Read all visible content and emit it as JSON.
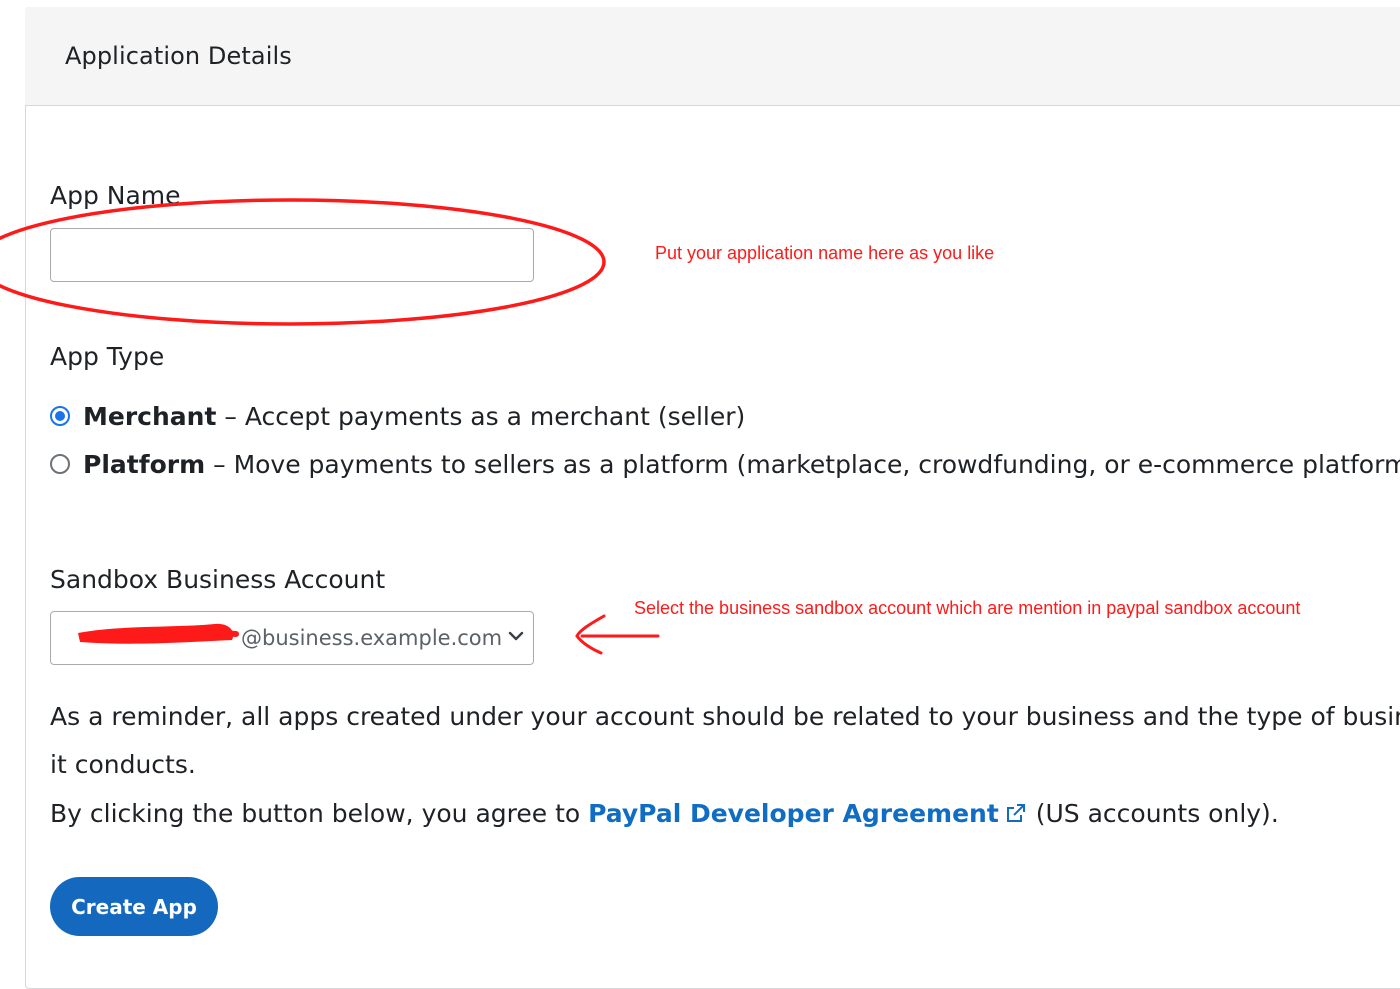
{
  "panel": {
    "title": "Application Details"
  },
  "form": {
    "app_name_label": "App Name",
    "app_name_value": "",
    "app_type_label": "App Type",
    "app_types": [
      {
        "title": "Merchant",
        "separator": " – ",
        "description": "Accept payments as a merchant (seller)",
        "selected": true
      },
      {
        "title": "Platform",
        "separator": " – ",
        "description": "Move payments to sellers as a platform (marketplace, crowdfunding, or e-commerce platform)",
        "selected": false
      }
    ],
    "sandbox_account_label": "Sandbox Business Account",
    "sandbox_account_value": "@business.example.com",
    "reminder_line1": "As a reminder, all apps created under your account should be related to your business and the type of business",
    "reminder_line2": "it conducts.",
    "agreement_prefix": "By clicking the button below, you agree to ",
    "agreement_link": "PayPal Developer Agreement",
    "agreement_suffix": " (US accounts only).",
    "create_button": "Create App"
  },
  "annotations": {
    "app_name_note": "Put your application name here as you like",
    "sandbox_note": "Select the business sandbox account which are mention in paypal sandbox account",
    "color": "#ff1a1a"
  },
  "icons": {
    "external_link": "external-link-icon",
    "select_arrow": "chevron-down-icon"
  }
}
